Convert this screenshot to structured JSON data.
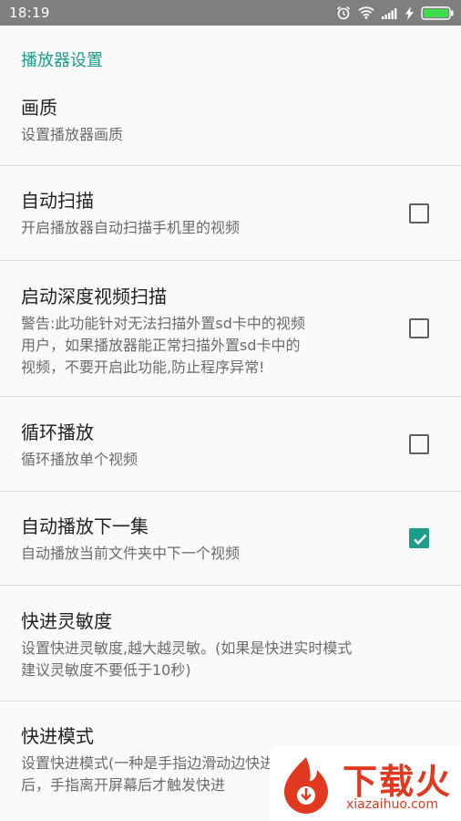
{
  "status_bar": {
    "time": "18:19",
    "icons": [
      "alarm-icon",
      "wifi-icon",
      "signal-icon",
      "charging-icon",
      "battery-icon"
    ]
  },
  "section": {
    "title": "播放器设置"
  },
  "prefs": [
    {
      "title": "画质",
      "summary": "设置播放器画质"
    },
    {
      "title": "自动扫描",
      "summary": "开启播放器自动扫描手机里的视频",
      "checked": false
    },
    {
      "title": "启动深度视频扫描",
      "summary_lines": [
        "警告:此功能针对无法扫描外置sd卡中的视频",
        "用户，如果播放器能正常扫描外置sd卡中的",
        "视频，不要开启此功能,防止程序异常!"
      ],
      "checked": false
    },
    {
      "title": "循环播放",
      "summary": "循环播放单个视频",
      "checked": false
    },
    {
      "title": "自动播放下一集",
      "summary": "自动播放当前文件夹中下一个视频",
      "checked": true
    },
    {
      "title": "快进灵敏度",
      "summary_lines": [
        "设置快进灵敏度,越大越灵敏。(如果是快进实时模式",
        "建议灵敏度不要低于10秒)"
      ]
    },
    {
      "title": "快进模式",
      "summary_lines": [
        "设置快进模式(一种是手指边滑动边快进，一种是滑动",
        "后，手指离开屏幕后才触发快进"
      ]
    }
  ],
  "watermark": {
    "title": "下载火",
    "url": "xiazaihuo.com"
  },
  "colors": {
    "accent": "#1e9c8c",
    "status_bar": "#7f7f7f",
    "watermark": "#e0391f"
  }
}
